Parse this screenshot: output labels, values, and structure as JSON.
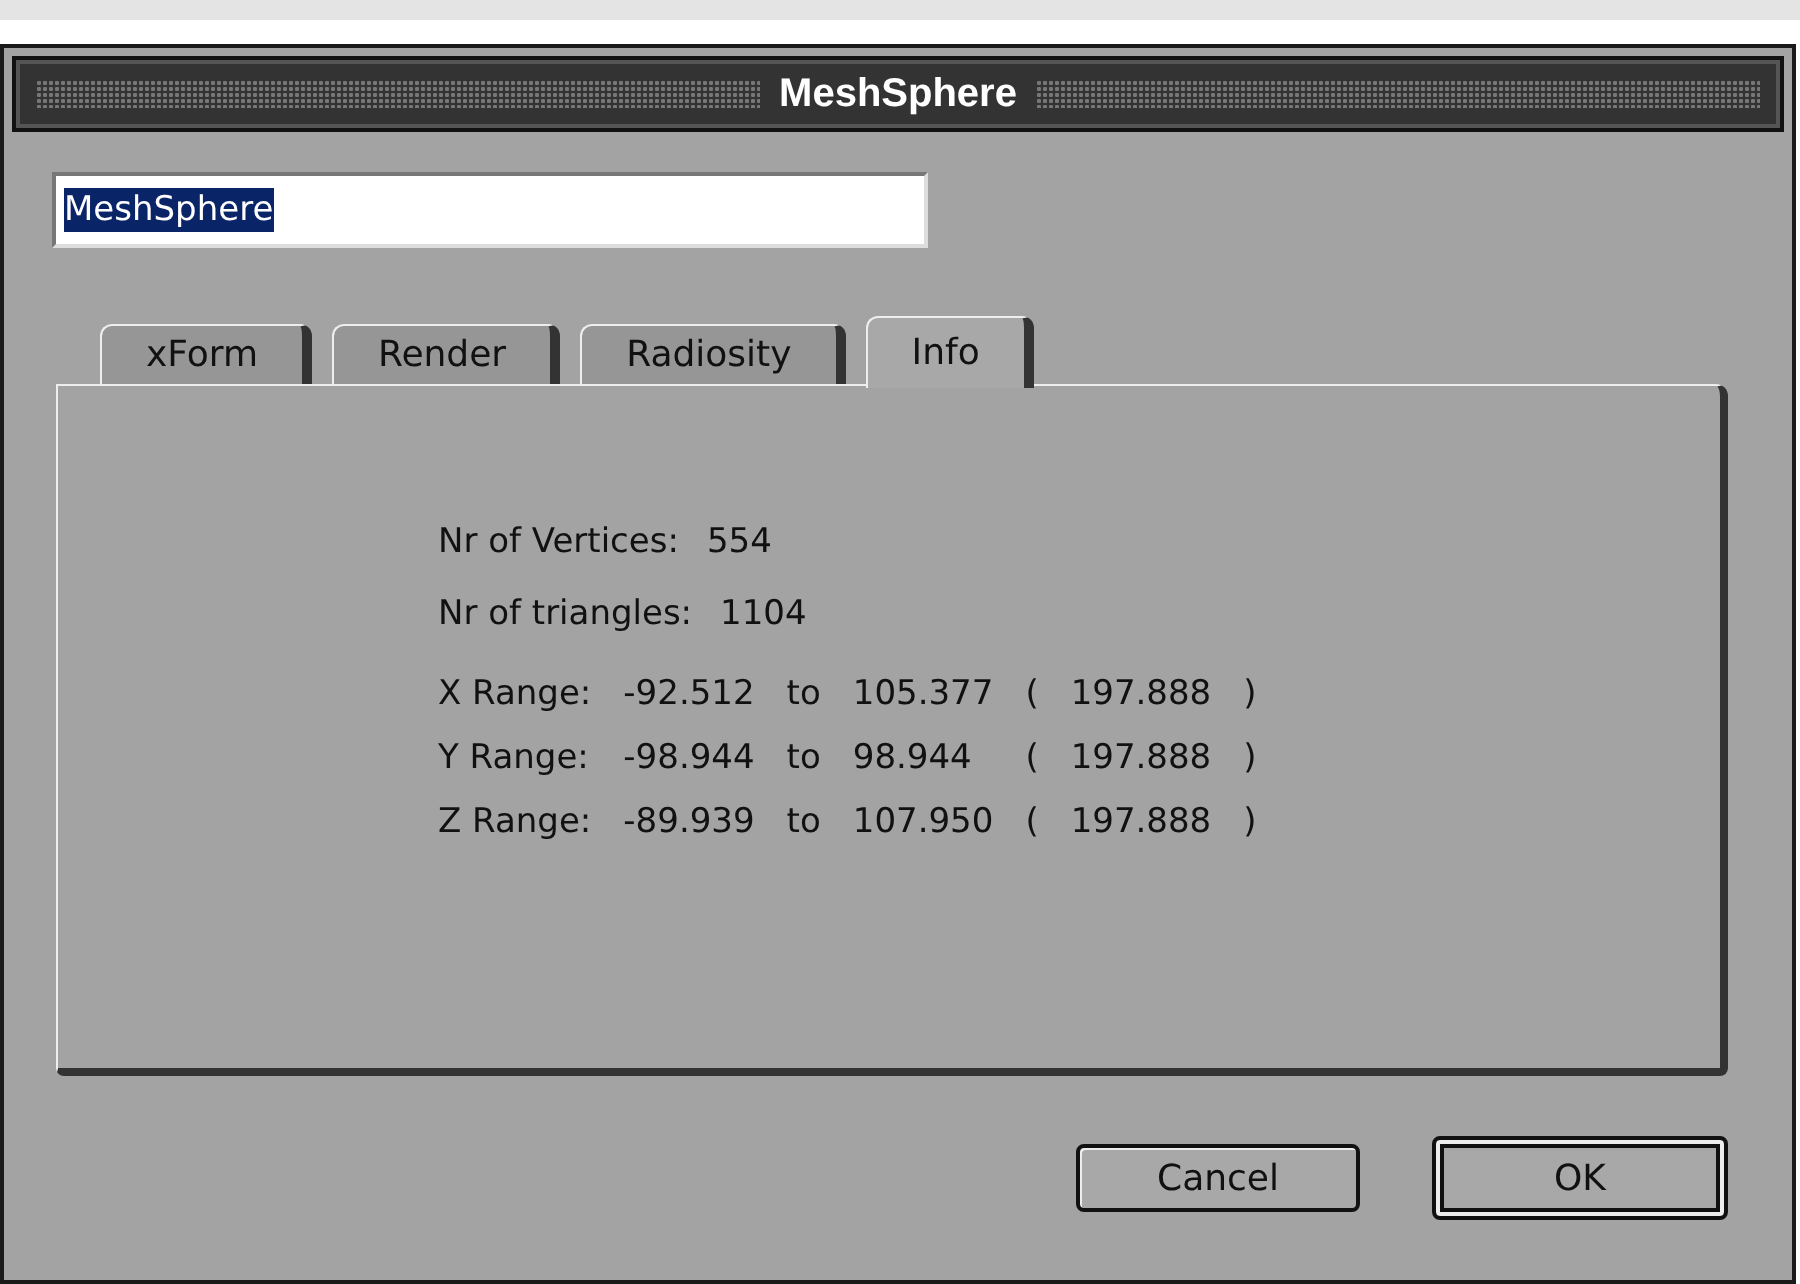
{
  "window": {
    "title": "MeshSphere"
  },
  "name_field": {
    "value": "MeshSphere",
    "selected": true
  },
  "tabs": [
    {
      "label": "xForm",
      "selected": false
    },
    {
      "label": "Render",
      "selected": false
    },
    {
      "label": "Radiosity",
      "selected": false
    },
    {
      "label": "Info",
      "selected": true
    }
  ],
  "counts": [
    {
      "label": "Nr of Vertices:",
      "value": "554"
    },
    {
      "label": "Nr of triangles:",
      "value": "1104"
    }
  ],
  "ranges": [
    {
      "label": "X Range:",
      "min": "-92.512",
      "to": "to",
      "max": "105.377",
      "open": "(",
      "span": "197.888",
      "close": ")"
    },
    {
      "label": "Y Range:",
      "min": "-98.944",
      "to": "to",
      "max": "98.944",
      "open": "(",
      "span": "197.888",
      "close": ")"
    },
    {
      "label": "Z Range:",
      "min": "-89.939",
      "to": "to",
      "max": "107.950",
      "open": "(",
      "span": "197.888",
      "close": ")"
    }
  ],
  "buttons": [
    {
      "label": "Cancel",
      "default": false
    },
    {
      "label": "OK",
      "default": true
    }
  ]
}
